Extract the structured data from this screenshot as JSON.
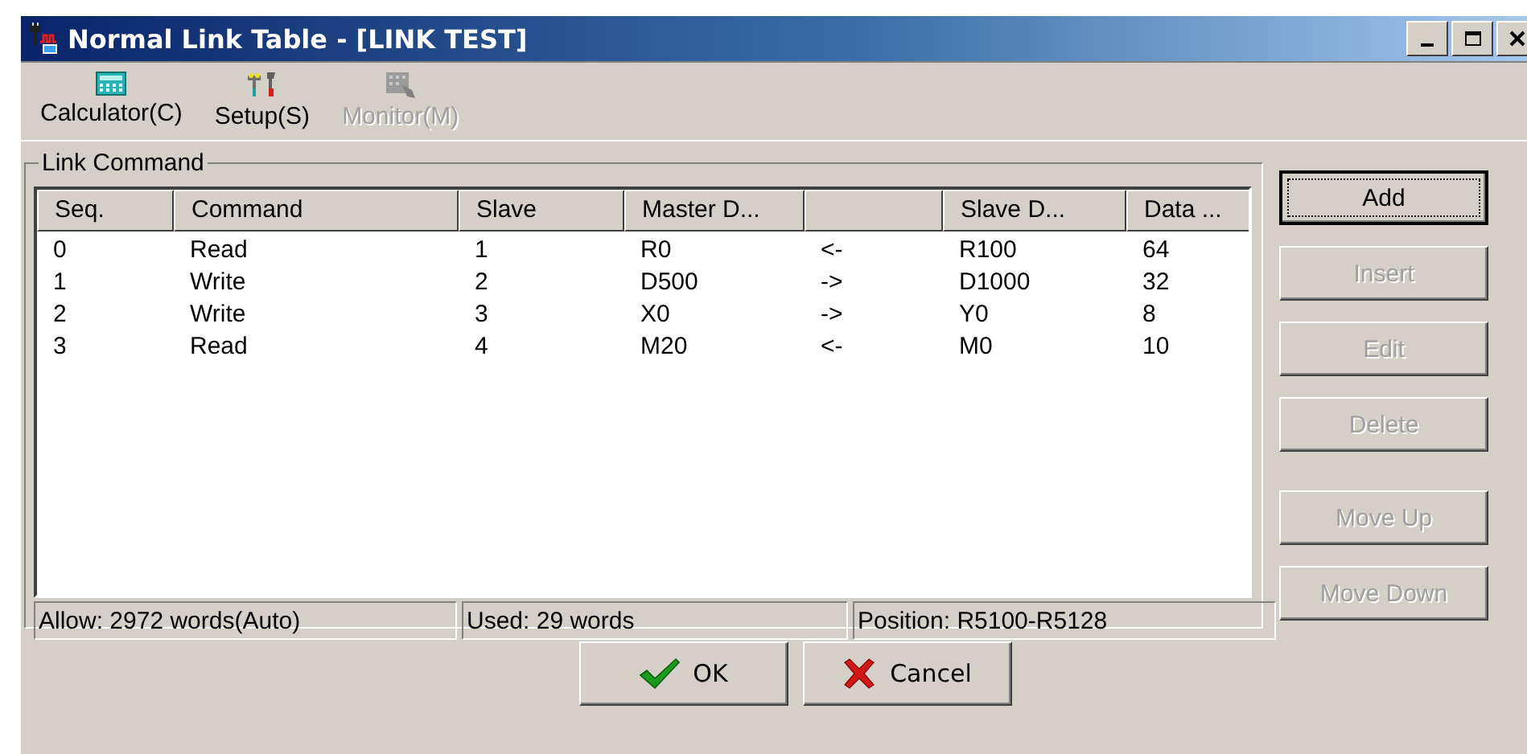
{
  "window": {
    "title": "Normal Link Table - [LINK TEST]",
    "controls": [
      {
        "kind": "minimize"
      },
      {
        "kind": "maximize"
      },
      {
        "kind": "close"
      }
    ]
  },
  "toolbar": [
    {
      "label": "Calculator(C)",
      "kind": "calculator",
      "disabled": false
    },
    {
      "label": "Setup(S)",
      "kind": "setup",
      "disabled": false
    },
    {
      "label": "Monitor(M)",
      "kind": "monitor",
      "disabled": true
    }
  ],
  "link_command": {
    "title": "Link Command",
    "columns": [
      "Seq.",
      "Command",
      "Slave",
      "Master D...",
      "",
      "Slave D...",
      "Data ..."
    ],
    "rows": [
      [
        "0",
        "Read",
        "1",
        "R0",
        "<-",
        "R100",
        "64"
      ],
      [
        "1",
        "Write",
        "2",
        "D500",
        "->",
        "D1000",
        "32"
      ],
      [
        "2",
        "Write",
        "3",
        "X0",
        "->",
        "Y0",
        "8"
      ],
      [
        "3",
        "Read",
        "4",
        "M20",
        "<-",
        "M0",
        "10"
      ]
    ],
    "status_bar": [
      "Allow: 2972 words(Auto)",
      "Used: 29 words",
      "Position: R5100-R5128"
    ]
  },
  "side_button_groups": [
    [
      {
        "label": "Add",
        "disabled": false,
        "focused": true
      },
      {
        "label": "Insert",
        "disabled": true,
        "focused": false
      },
      {
        "label": "Edit",
        "disabled": true,
        "focused": false
      },
      {
        "label": "Delete",
        "disabled": true,
        "focused": false
      }
    ],
    [
      {
        "label": "Move Up",
        "disabled": true,
        "focused": false
      },
      {
        "label": "Move Down",
        "disabled": true,
        "focused": false
      }
    ]
  ],
  "bottom_buttons": [
    {
      "label": "OK",
      "kind": "ok"
    },
    {
      "label": "Cancel",
      "kind": "cancel"
    }
  ]
}
